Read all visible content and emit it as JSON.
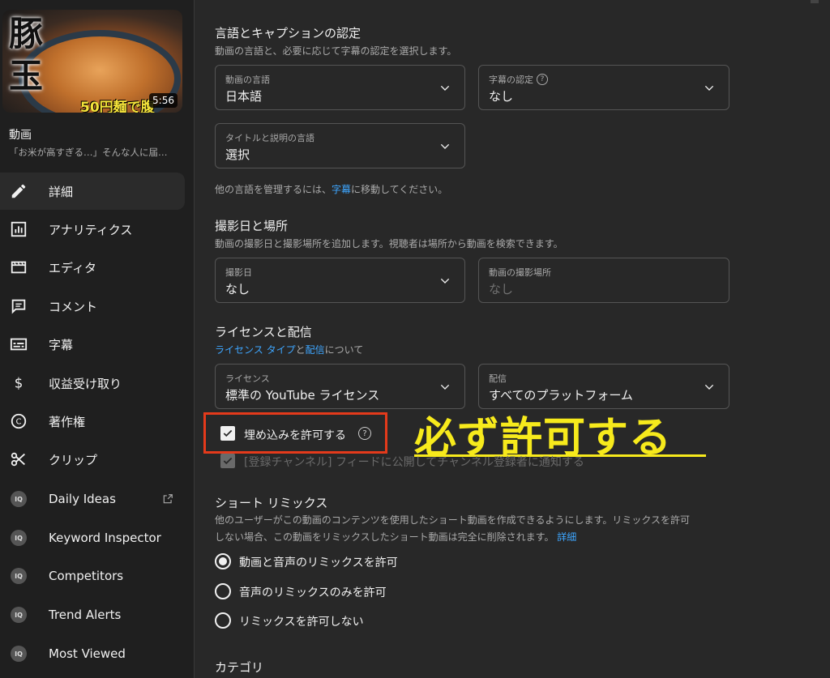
{
  "sidebar": {
    "thumbnail": {
      "overlay_text": "豚玉",
      "price_text": "50円麺で腹",
      "duration": "5:56"
    },
    "video_label": "動画",
    "video_title": "「お米が高すぎる…」そんな人に届…",
    "items": [
      {
        "label": "詳細",
        "icon": "pencil-icon",
        "active": true
      },
      {
        "label": "アナリティクス",
        "icon": "analytics-icon"
      },
      {
        "label": "エディタ",
        "icon": "editor-icon"
      },
      {
        "label": "コメント",
        "icon": "comment-icon"
      },
      {
        "label": "字幕",
        "icon": "subtitles-icon"
      },
      {
        "label": "収益受け取り",
        "icon": "dollar-icon"
      },
      {
        "label": "著作権",
        "icon": "copyright-icon"
      },
      {
        "label": "クリップ",
        "icon": "scissors-icon"
      },
      {
        "label": "Daily Ideas",
        "icon": "iq-icon",
        "external": true
      },
      {
        "label": "Keyword Inspector",
        "icon": "iq-icon"
      },
      {
        "label": "Competitors",
        "icon": "iq-icon"
      },
      {
        "label": "Trend Alerts",
        "icon": "iq-icon"
      },
      {
        "label": "Most Viewed",
        "icon": "iq-icon"
      }
    ]
  },
  "main": {
    "language": {
      "title": "言語とキャプションの認定",
      "desc": "動画の言語と、必要に応じて字幕の認定を選択します。",
      "video_lang_label": "動画の言語",
      "video_lang_value": "日本語",
      "caption_cert_label": "字幕の認定",
      "caption_cert_value": "なし",
      "title_lang_label": "タイトルと説明の言語",
      "title_lang_value": "選択",
      "manage_prefix": "他の言語を管理するには、",
      "manage_link": "字幕",
      "manage_suffix": "に移動してください。"
    },
    "recording": {
      "title": "撮影日と場所",
      "desc": "動画の撮影日と撮影場所を追加します。視聴者は場所から動画を検索できます。",
      "date_label": "撮影日",
      "date_value": "なし",
      "location_label": "動画の撮影場所",
      "location_placeholder": "なし"
    },
    "license": {
      "title": "ライセンスと配信",
      "link1": "ライセンス タイプ",
      "and": "と",
      "link2": "配信",
      "about": "について",
      "license_label": "ライセンス",
      "license_value": "標準の YouTube ライセンス",
      "dist_label": "配信",
      "dist_value": "すべてのプラットフォーム",
      "embed_label": "埋め込みを許可する",
      "subs_label": "[登録チャンネル] フィードに公開してチャンネル登録者に通知する"
    },
    "annotation": "必ず許可する",
    "shorts": {
      "title": "ショート リミックス",
      "desc1": "他のユーザーがこの動画のコンテンツを使用したショート動画を作成できるようにします。リミックスを許可",
      "desc2": "しない場合、この動画をリミックスしたショート動画は完全に削除されます。",
      "details_link": "詳細",
      "options": [
        {
          "label": "動画と音声のリミックスを許可",
          "checked": true
        },
        {
          "label": "音声のリミックスのみを許可",
          "checked": false
        },
        {
          "label": "リミックスを許可しない",
          "checked": false
        }
      ]
    },
    "category": {
      "title": "カテゴリ"
    }
  },
  "colors": {
    "accent_link": "#3ea6ff",
    "highlight_box": "#e43a1b",
    "annotation_yellow": "#f7ea1c"
  }
}
